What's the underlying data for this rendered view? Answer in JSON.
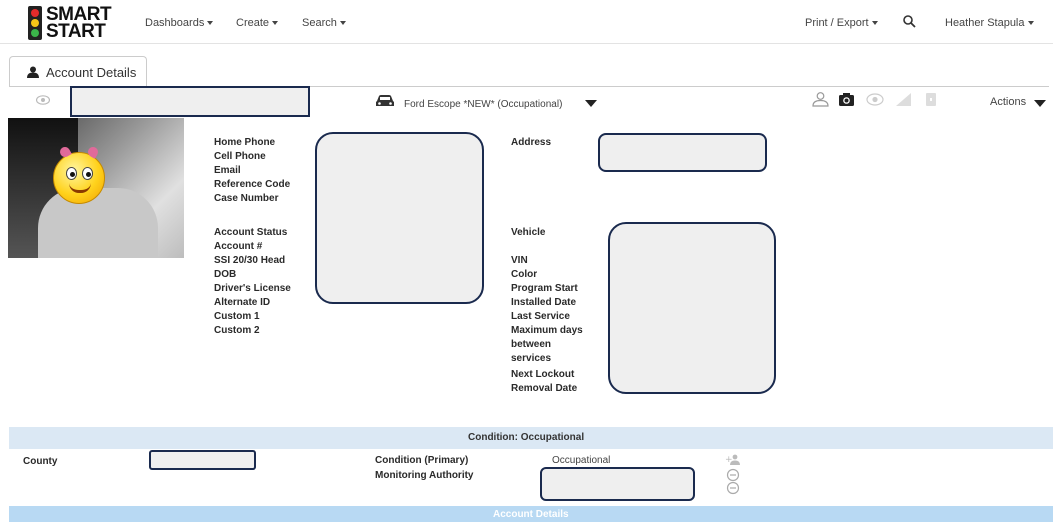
{
  "brand": {
    "line1": "SMART",
    "line2": "START"
  },
  "nav": {
    "dashboards": "Dashboards",
    "create": "Create",
    "search": "Search",
    "print_export": "Print / Export",
    "user": "Heather Stapula"
  },
  "tab": {
    "label": "Account Details"
  },
  "toolbar": {
    "vehicle": "Ford Escope *NEW* (Occupational)",
    "actions": "Actions"
  },
  "left_fields": {
    "home_phone": "Home Phone",
    "cell_phone": "Cell Phone",
    "email": "Email",
    "reference_code": "Reference Code",
    "case_number": "Case Number",
    "account_status": "Account Status",
    "account_num": "Account #",
    "ssi": "SSI 20/30 Head",
    "dob": "DOB",
    "drivers_license": "Driver's License",
    "alternate_id": "Alternate ID",
    "custom1": "Custom 1",
    "custom2": "Custom 2"
  },
  "right_fields": {
    "address": "Address",
    "vehicle": "Vehicle",
    "vin": "VIN",
    "color": "Color",
    "program_start": "Program Start",
    "installed_date": "Installed Date",
    "last_service": "Last Service",
    "max_days_1": "Maximum days",
    "max_days_2": "between",
    "max_days_3": "services",
    "next_lockout": "Next Lockout",
    "removal_date": "Removal Date"
  },
  "condition": {
    "title": "Condition: Occupational",
    "county_label": "County",
    "primary_label": "Condition (Primary)",
    "primary_value": "Occupational",
    "monitoring_label": "Monitoring Authority"
  },
  "account_band": {
    "title": "Account Details"
  },
  "colors": {
    "redaction_border": "#1a2a4e",
    "band": "#dbe8f4",
    "band_strong": "#b8d9f3"
  }
}
